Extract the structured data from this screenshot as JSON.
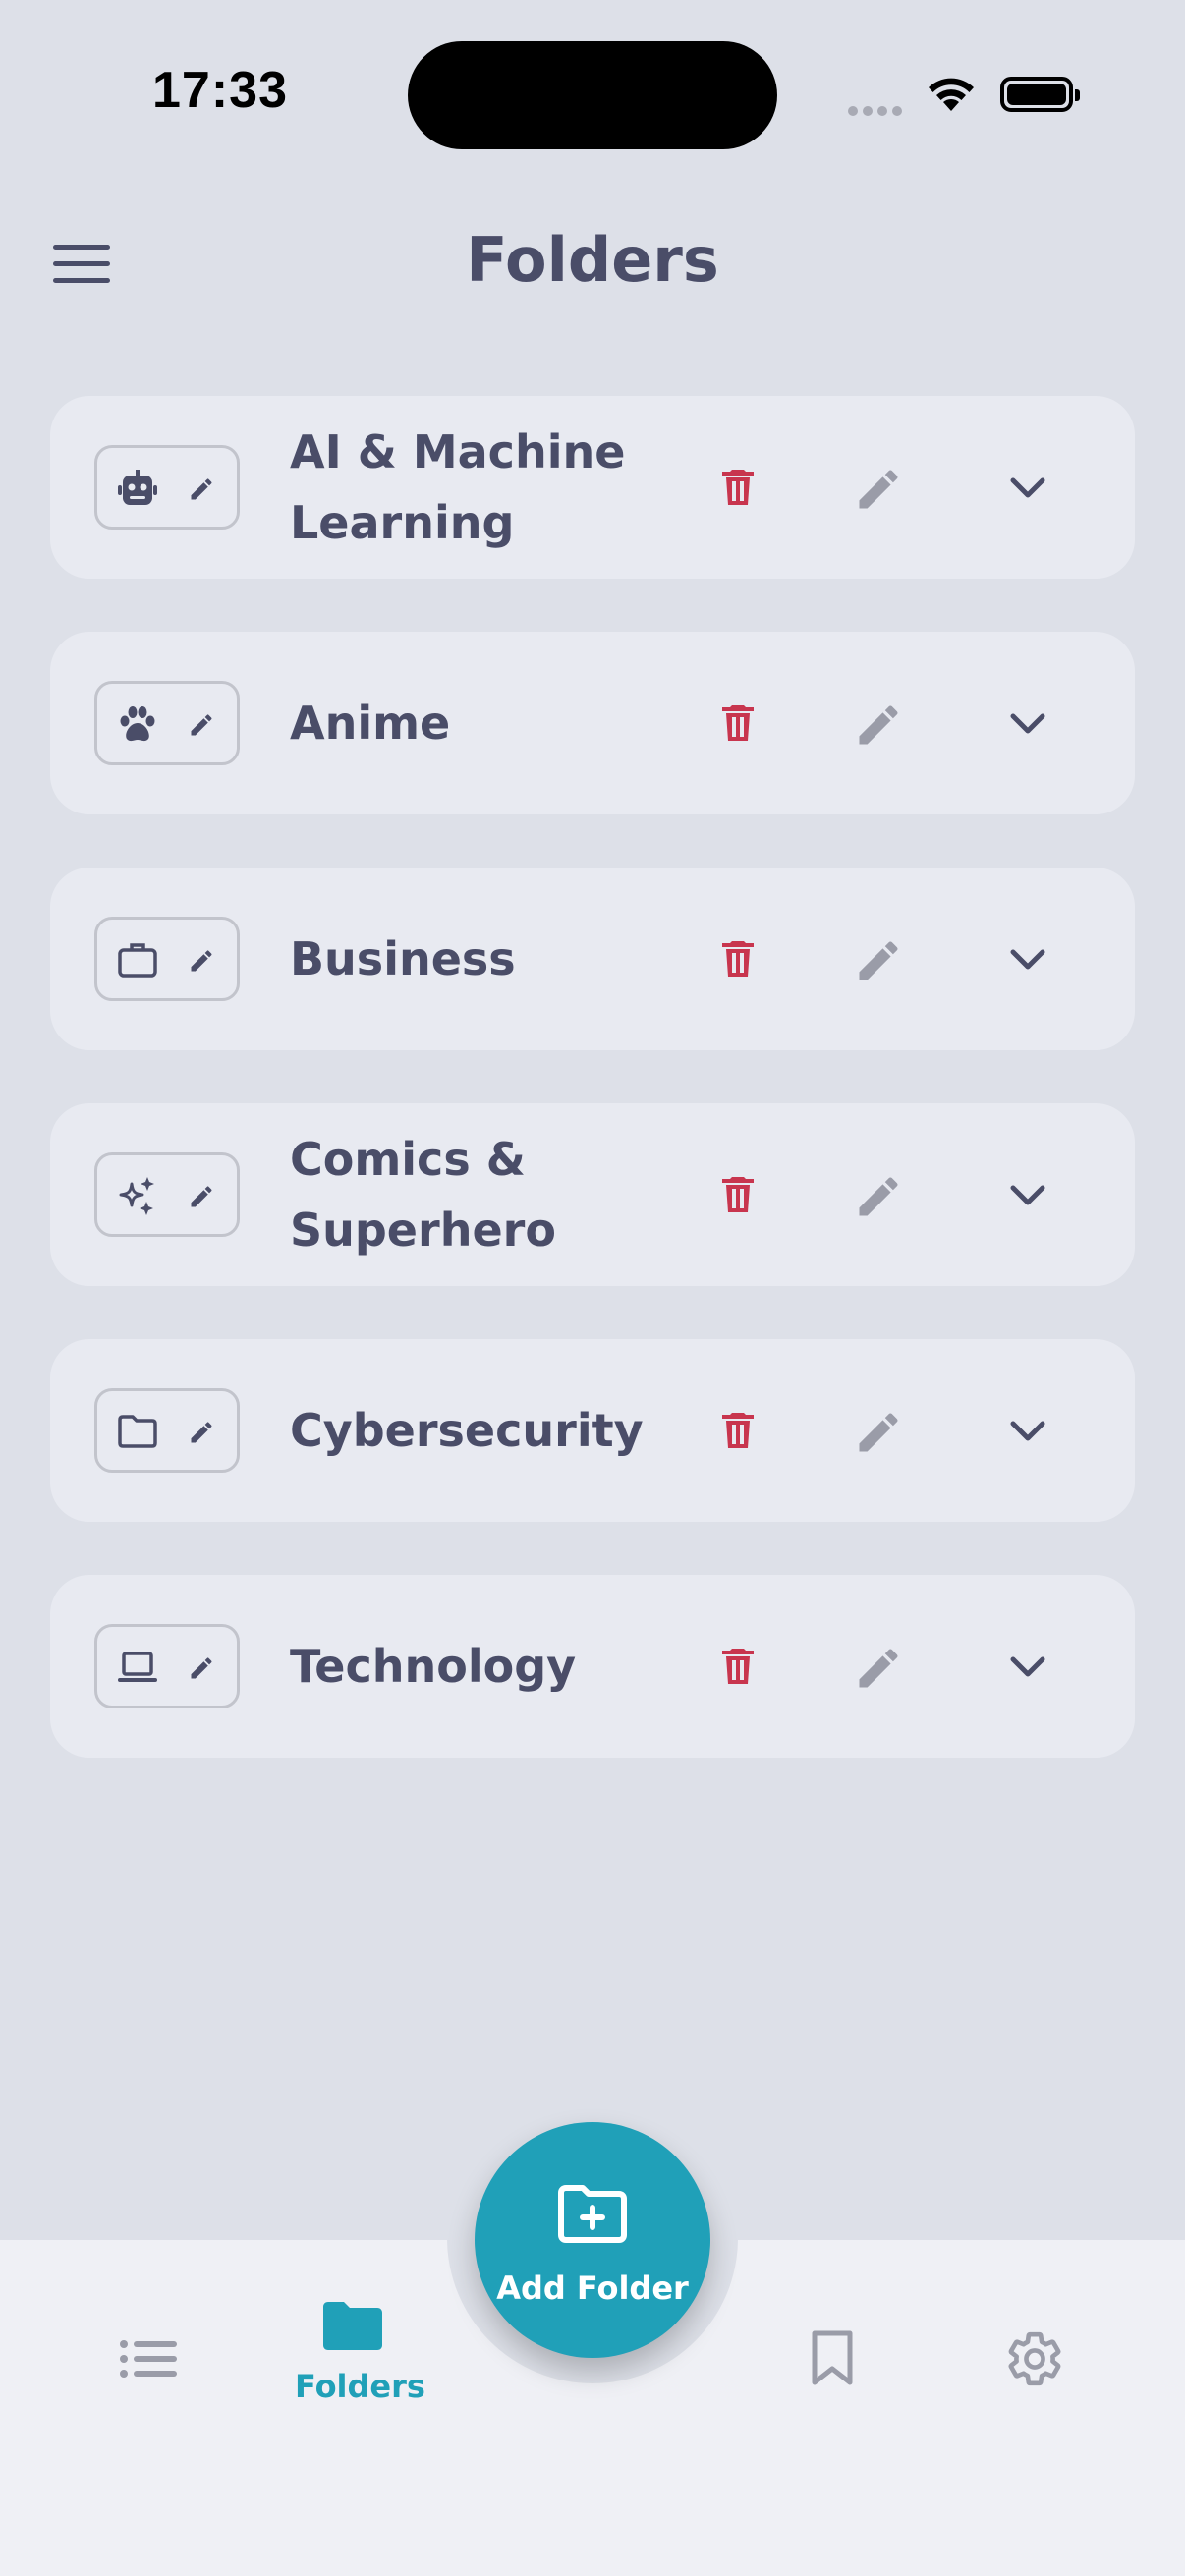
{
  "status_bar": {
    "time": "17:33"
  },
  "header": {
    "title": "Folders",
    "menu_icon": "hamburger-menu-icon"
  },
  "folders": [
    {
      "name": "AI & Machine Learning",
      "icon": "robot-icon"
    },
    {
      "name": "Anime",
      "icon": "paw-icon"
    },
    {
      "name": "Business",
      "icon": "briefcase-icon"
    },
    {
      "name": "Comics & Superhero",
      "icon": "sparkles-icon"
    },
    {
      "name": "Cybersecurity",
      "icon": "folder-outline-icon"
    },
    {
      "name": "Technology",
      "icon": "laptop-icon"
    }
  ],
  "row_actions": {
    "delete_icon": "trash-icon",
    "edit_icon": "pencil-icon",
    "expand_icon": "chevron-down-icon"
  },
  "fab": {
    "label": "Add Folder",
    "icon": "folder-plus-icon"
  },
  "bottom_nav": {
    "items": [
      {
        "icon": "list-icon",
        "label": ""
      },
      {
        "icon": "folder-icon",
        "label": "Folders",
        "active": true
      },
      {
        "icon": "bookmark-icon",
        "label": ""
      },
      {
        "icon": "gear-icon",
        "label": ""
      }
    ]
  },
  "colors": {
    "background": "#dde0e8",
    "card": "#e8eaf1",
    "text": "#4a4d68",
    "accent": "#20a0b8",
    "delete": "#c8354e",
    "edit": "#9a9ca8",
    "nav_background": "#eff0f5"
  }
}
